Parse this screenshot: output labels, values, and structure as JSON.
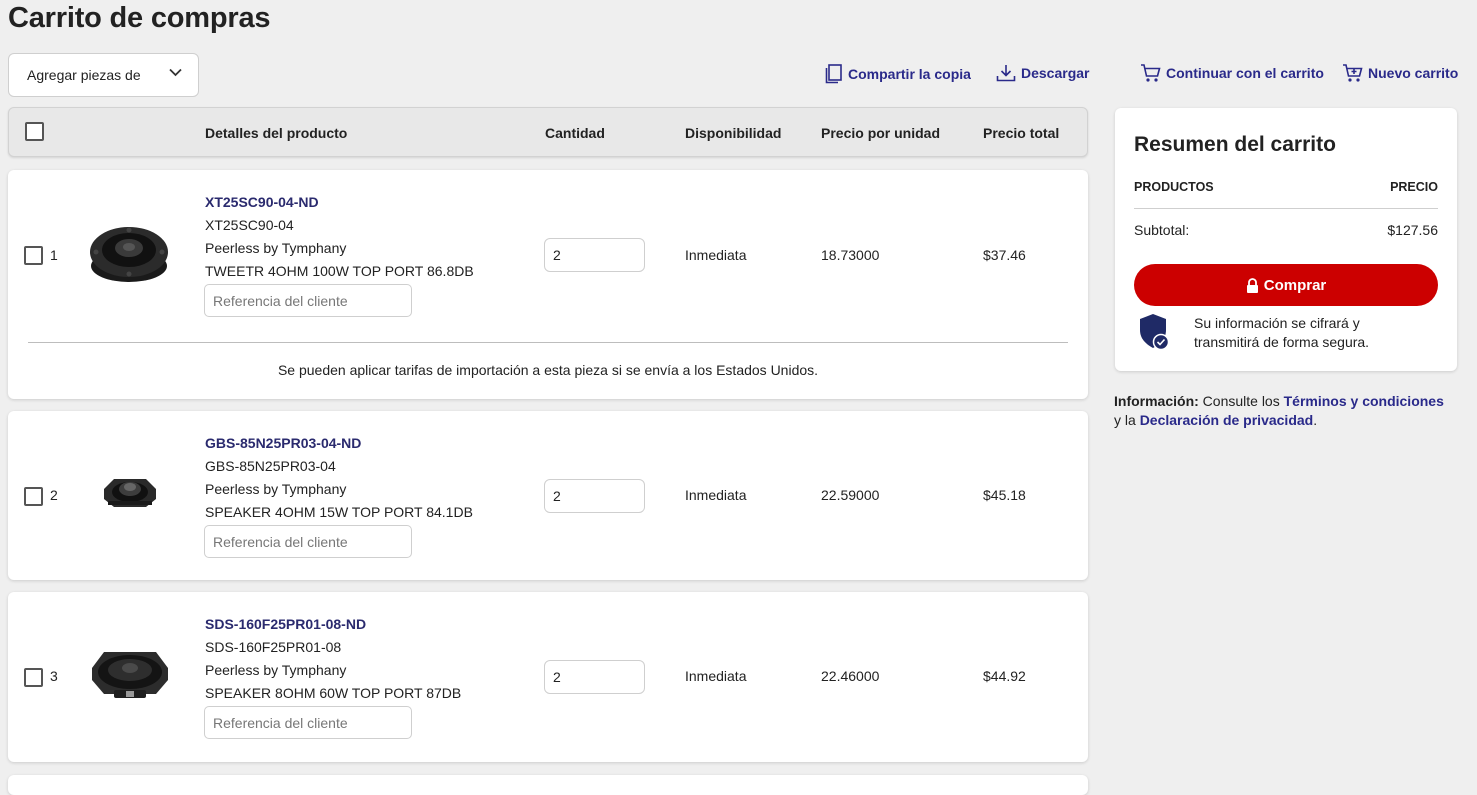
{
  "page": {
    "title": "Carrito de compras"
  },
  "toolbar": {
    "add_parts": "Agregar piezas de",
    "share": "Compartir la copia",
    "download": "Descargar",
    "continue_cart": "Continuar con el carrito",
    "new_cart": "Nuevo carrito"
  },
  "table": {
    "headers": {
      "details": "Detalles del producto",
      "quantity": "Cantidad",
      "availability": "Disponibilidad",
      "unit_price": "Precio por unidad",
      "total_price": "Precio total"
    },
    "ref_placeholder": "Referencia del cliente",
    "items": [
      {
        "index": "1",
        "part_number": "XT25SC90-04-ND",
        "mfr_part": "XT25SC90-04",
        "manufacturer": "Peerless by Tymphany",
        "description": "TWEETR 4OHM 100W TOP PORT 86.8DB",
        "quantity": "2",
        "availability": "Inmediata",
        "unit_price": "18.73000",
        "total_price": "$37.46",
        "note": "Se pueden aplicar tarifas de importación a esta pieza si se envía a los Estados Unidos."
      },
      {
        "index": "2",
        "part_number": "GBS-85N25PR03-04-ND",
        "mfr_part": "GBS-85N25PR03-04",
        "manufacturer": "Peerless by Tymphany",
        "description": "SPEAKER 4OHM 15W TOP PORT 84.1DB",
        "quantity": "2",
        "availability": "Inmediata",
        "unit_price": "22.59000",
        "total_price": "$45.18"
      },
      {
        "index": "3",
        "part_number": "SDS-160F25PR01-08-ND",
        "mfr_part": "SDS-160F25PR01-08",
        "manufacturer": "Peerless by Tymphany",
        "description": "SPEAKER 8OHM 60W TOP PORT 87DB",
        "quantity": "2",
        "availability": "Inmediata",
        "unit_price": "22.46000",
        "total_price": "$44.92"
      }
    ]
  },
  "summary": {
    "title": "Resumen del carrito",
    "col_products": "PRODUCTOS",
    "col_price": "PRECIO",
    "subtotal_label": "Subtotal:",
    "subtotal_value": "$127.56",
    "buy_label": "Comprar",
    "secure_text": "Su información se cifrará y transmitirá de forma segura."
  },
  "info": {
    "label": "Información:",
    "text1": " Consulte los ",
    "terms": "Términos y condiciones",
    "text2": "y la ",
    "privacy": "Declaración de privacidad",
    "text3": "."
  },
  "colors": {
    "accent_link": "#2a2a8a",
    "buy_button": "#cc0000",
    "shield": "#1f2a66"
  }
}
